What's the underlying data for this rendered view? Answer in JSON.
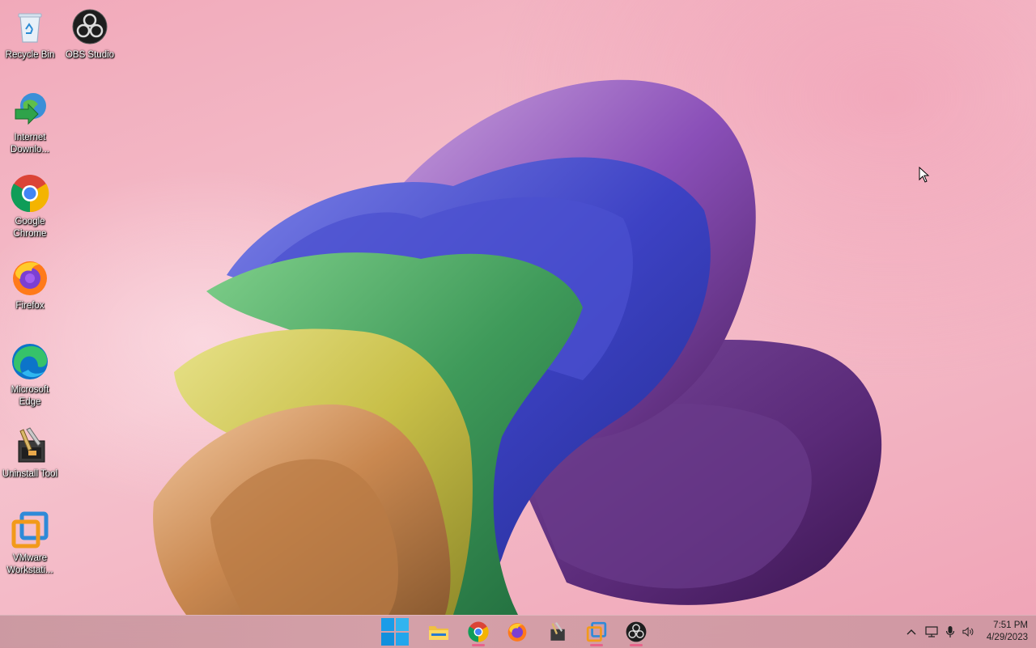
{
  "desktop": {
    "icons": [
      {
        "name": "recycle-bin",
        "label": "Recycle Bin"
      },
      {
        "name": "obs-studio",
        "label": "OBS Studio"
      },
      {
        "name": "internet-download-manager",
        "label": "Internet Downlo..."
      },
      {
        "name": "google-chrome",
        "label": "Google Chrome"
      },
      {
        "name": "firefox",
        "label": "Firefox"
      },
      {
        "name": "microsoft-edge",
        "label": "Microsoft Edge"
      },
      {
        "name": "uninstall-tool",
        "label": "Uninstall Tool"
      },
      {
        "name": "vmware-workstation",
        "label": "VMware Workstati..."
      }
    ]
  },
  "taskbar": {
    "pinned": [
      "start-icon",
      "file-explorer-icon",
      "chrome-icon",
      "firefox-icon",
      "uninstall-tool-icon",
      "vmware-icon",
      "obs-icon"
    ],
    "tray_icons": [
      "chevron-up-icon",
      "network-icon",
      "microphone-icon",
      "volume-icon"
    ],
    "clock": {
      "time": "7:51 PM",
      "date": "4/29/2023"
    }
  }
}
